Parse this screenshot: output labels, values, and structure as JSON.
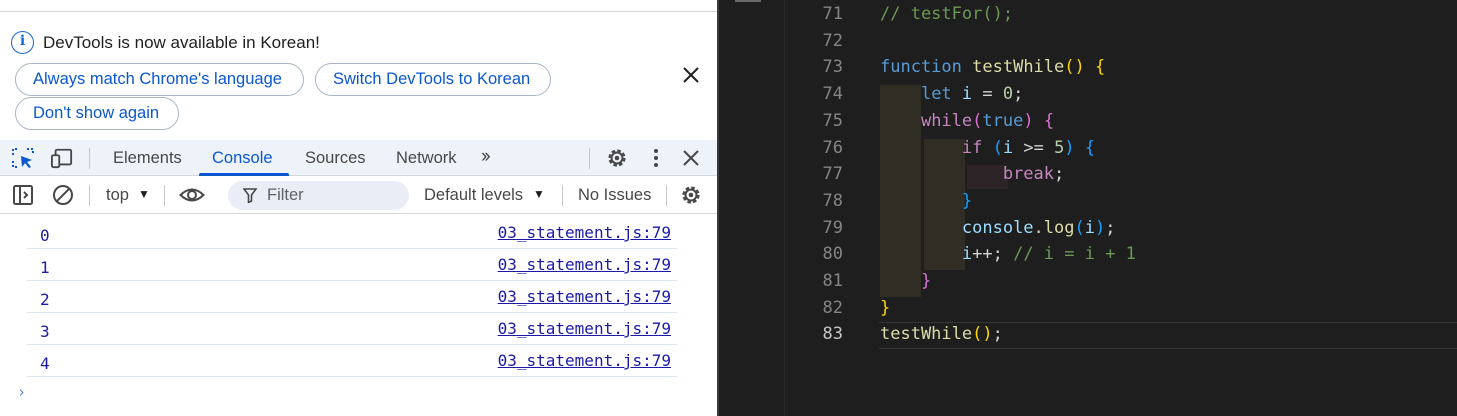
{
  "infobar": {
    "message": "DevTools is now available in Korean!",
    "buttons": [
      "Always match Chrome's language",
      "Switch DevTools to Korean",
      "Don't show again"
    ]
  },
  "tabs": [
    "Elements",
    "Console",
    "Sources",
    "Network"
  ],
  "active_tab": "Console",
  "toolbar": {
    "context": "top",
    "filter_placeholder": "Filter",
    "levels": "Default levels",
    "issues": "No Issues"
  },
  "console_logs": [
    {
      "value": "0",
      "source": "03_statement.js:79"
    },
    {
      "value": "1",
      "source": "03_statement.js:79"
    },
    {
      "value": "2",
      "source": "03_statement.js:79"
    },
    {
      "value": "3",
      "source": "03_statement.js:79"
    },
    {
      "value": "4",
      "source": "03_statement.js:79"
    }
  ],
  "prompt_symbol": "›",
  "editor": {
    "line_numbers": [
      "71",
      "72",
      "73",
      "74",
      "75",
      "76",
      "77",
      "78",
      "79",
      "80",
      "81",
      "82",
      "83"
    ],
    "active_line": "83",
    "lines": [
      [
        {
          "t": "// testFor();",
          "c": "com"
        }
      ],
      [],
      [
        {
          "t": "function",
          "c": "kw"
        },
        {
          "t": " ",
          "c": ""
        },
        {
          "t": "testWhile",
          "c": "fn"
        },
        {
          "t": "()",
          "c": "y"
        },
        {
          "t": " ",
          "c": ""
        },
        {
          "t": "{",
          "c": "y"
        }
      ],
      [
        {
          "t": "    ",
          "c": ""
        },
        {
          "t": "let",
          "c": "kw"
        },
        {
          "t": " ",
          "c": ""
        },
        {
          "t": "i",
          "c": "var"
        },
        {
          "t": " = ",
          "c": ""
        },
        {
          "t": "0",
          "c": "num"
        },
        {
          "t": ";",
          "c": ""
        }
      ],
      [
        {
          "t": "    ",
          "c": ""
        },
        {
          "t": "while",
          "c": "ctl"
        },
        {
          "t": "(",
          "c": "p"
        },
        {
          "t": "true",
          "c": "kw"
        },
        {
          "t": ")",
          "c": "p"
        },
        {
          "t": " ",
          "c": ""
        },
        {
          "t": "{",
          "c": "p"
        }
      ],
      [
        {
          "t": "        ",
          "c": ""
        },
        {
          "t": "if",
          "c": "ctl"
        },
        {
          "t": " ",
          "c": ""
        },
        {
          "t": "(",
          "c": "b"
        },
        {
          "t": "i",
          "c": "var"
        },
        {
          "t": " >= ",
          "c": ""
        },
        {
          "t": "5",
          "c": "num"
        },
        {
          "t": ")",
          "c": "b"
        },
        {
          "t": " ",
          "c": ""
        },
        {
          "t": "{",
          "c": "b"
        }
      ],
      [
        {
          "t": "            ",
          "c": ""
        },
        {
          "t": "break",
          "c": "ctl"
        },
        {
          "t": ";",
          "c": ""
        }
      ],
      [
        {
          "t": "        ",
          "c": ""
        },
        {
          "t": "}",
          "c": "b"
        }
      ],
      [
        {
          "t": "        ",
          "c": ""
        },
        {
          "t": "console",
          "c": "var"
        },
        {
          "t": ".",
          "c": ""
        },
        {
          "t": "log",
          "c": "fn"
        },
        {
          "t": "(",
          "c": "b"
        },
        {
          "t": "i",
          "c": "var"
        },
        {
          "t": ")",
          "c": "b"
        },
        {
          "t": ";",
          "c": ""
        }
      ],
      [
        {
          "t": "        ",
          "c": ""
        },
        {
          "t": "i",
          "c": "var"
        },
        {
          "t": "++; ",
          "c": ""
        },
        {
          "t": "// i = i + 1",
          "c": "com"
        }
      ],
      [
        {
          "t": "    ",
          "c": ""
        },
        {
          "t": "}",
          "c": "p"
        }
      ],
      [
        {
          "t": "}",
          "c": "y"
        }
      ],
      [
        {
          "t": "testWhile",
          "c": "fn"
        },
        {
          "t": "()",
          "c": "y"
        },
        {
          "t": ";",
          "c": ""
        }
      ]
    ]
  }
}
